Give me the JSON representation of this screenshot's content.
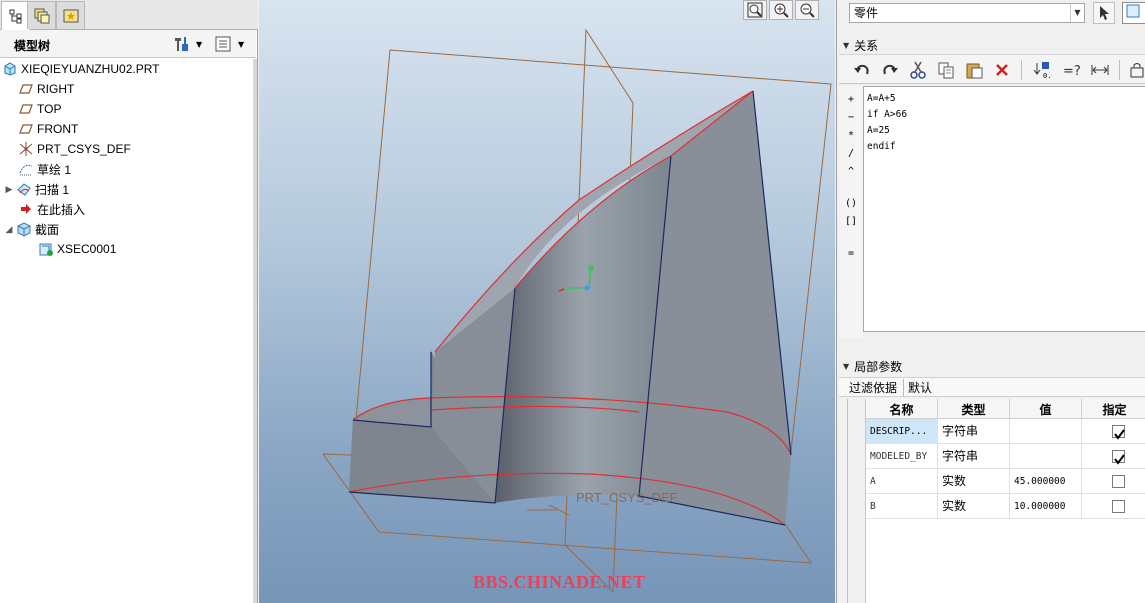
{
  "left_tabs": [
    "model-tree-tab",
    "layers-tab",
    "favorites-tab"
  ],
  "tree_panel": {
    "title": "模型树",
    "items": [
      {
        "label": "XIEQIEYUANZHU02.PRT",
        "icon": "part-icon",
        "level": 0,
        "expander": ""
      },
      {
        "label": "RIGHT",
        "icon": "datum-plane-icon",
        "level": 1,
        "expander": ""
      },
      {
        "label": "TOP",
        "icon": "datum-plane-icon",
        "level": 1,
        "expander": ""
      },
      {
        "label": "FRONT",
        "icon": "datum-plane-icon",
        "level": 1,
        "expander": ""
      },
      {
        "label": "PRT_CSYS_DEF",
        "icon": "csys-icon",
        "level": 1,
        "expander": ""
      },
      {
        "label": "草绘 1",
        "icon": "sketch-icon",
        "level": 1,
        "expander": ""
      },
      {
        "label": "扫描 1",
        "icon": "sweep-icon",
        "level": 1,
        "expander": "▶"
      },
      {
        "label": "在此插入",
        "icon": "insert-here-icon",
        "level": 1,
        "expander": ""
      },
      {
        "label": "截面",
        "icon": "section-folder-icon",
        "level": 1,
        "expander": "◢"
      },
      {
        "label": "XSEC0001",
        "icon": "section-icon",
        "level": 2,
        "expander": ""
      }
    ]
  },
  "viewport": {
    "csys_label": "PRT_CSYS_DEF",
    "watermark": "BBS.CHINADE.NET",
    "toolbar": [
      "zoom-fit-icon",
      "zoom-in-icon",
      "zoom-out-icon"
    ]
  },
  "relations_panel": {
    "object_type": "零件",
    "section_title": "关系",
    "editor_lines": [
      "A=A+5",
      "if A>66",
      "A=25",
      "endif"
    ],
    "operators": [
      "+",
      "−",
      "*",
      "/",
      "^",
      "()",
      "[]",
      "="
    ]
  },
  "params_panel": {
    "section_title": "局部参数",
    "filter_label": "过滤依据",
    "filter_value": "默认",
    "columns": [
      "名称",
      "类型",
      "值",
      "指定"
    ],
    "rows": [
      {
        "name": "DESCRIP...",
        "type": "字符串",
        "value": "",
        "designate": true
      },
      {
        "name": "MODELED_BY",
        "type": "字符串",
        "value": "",
        "designate": true
      },
      {
        "name": "A",
        "type": "实数",
        "value": "45.000000",
        "designate": false
      },
      {
        "name": "B",
        "type": "实数",
        "value": "10.000000",
        "designate": false
      }
    ]
  },
  "colors": {
    "model_edge": "#e03030",
    "datum": "#9a6a40",
    "selection": "#cfe6f8"
  }
}
